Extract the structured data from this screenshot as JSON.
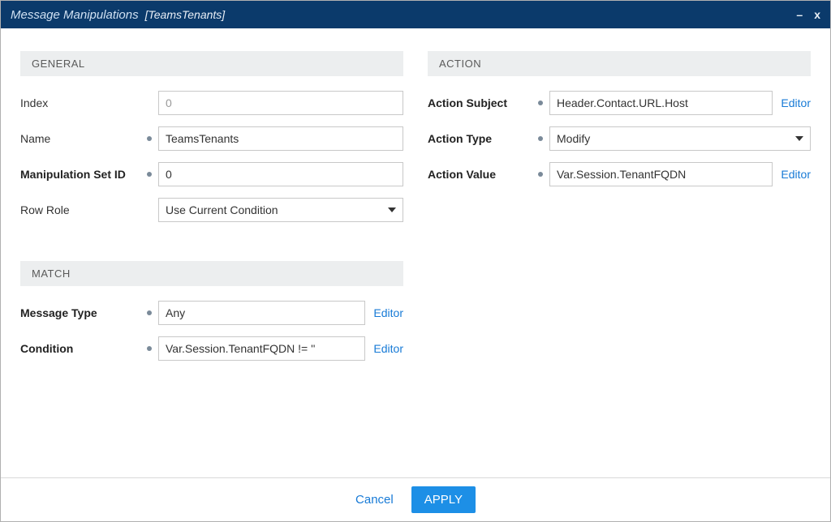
{
  "titlebar": {
    "title": "Message Manipulations",
    "subtitle": "[TeamsTenants]"
  },
  "sections": {
    "general": {
      "header": "GENERAL"
    },
    "match": {
      "header": "MATCH"
    },
    "action": {
      "header": "ACTION"
    }
  },
  "general": {
    "index_label": "Index",
    "index_value": "0",
    "name_label": "Name",
    "name_value": "TeamsTenants",
    "manip_label": "Manipulation Set ID",
    "manip_value": "0",
    "rowrole_label": "Row Role",
    "rowrole_value": "Use Current Condition"
  },
  "match": {
    "msgtype_label": "Message Type",
    "msgtype_value": "Any",
    "condition_label": "Condition",
    "condition_value": "Var.Session.TenantFQDN != ''"
  },
  "action": {
    "subject_label": "Action Subject",
    "subject_value": "Header.Contact.URL.Host",
    "type_label": "Action Type",
    "type_value": "Modify",
    "value_label": "Action Value",
    "value_value": "Var.Session.TenantFQDN"
  },
  "links": {
    "editor": "Editor"
  },
  "footer": {
    "cancel": "Cancel",
    "apply": "APPLY"
  }
}
